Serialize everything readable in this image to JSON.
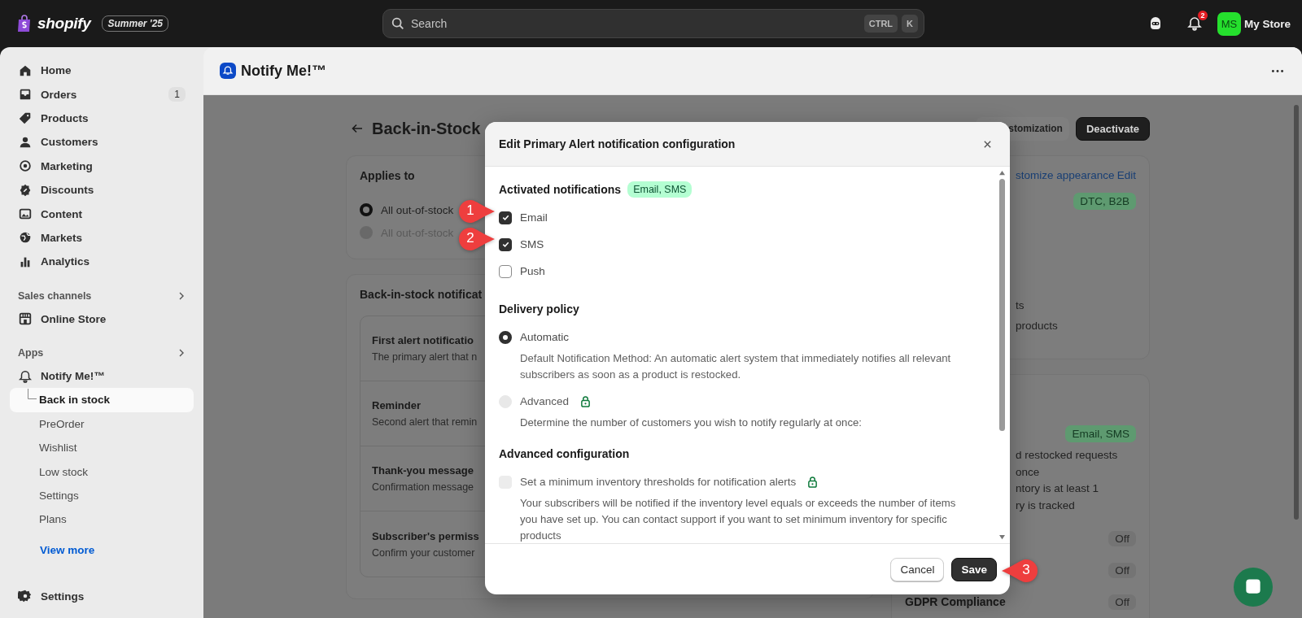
{
  "topbar": {
    "logo": "shopify",
    "edition": "Summer '25",
    "search": {
      "placeholder": "Search"
    },
    "shortcut": [
      "CTRL",
      "K"
    ],
    "notification_count": "2",
    "avatar": "MS",
    "store": "My Store"
  },
  "sidebar": {
    "nav": [
      {
        "label": "Home",
        "selected": false
      },
      {
        "label": "Orders",
        "badge": "1",
        "selected": false
      },
      {
        "label": "Products",
        "selected": false
      },
      {
        "label": "Customers",
        "selected": false
      },
      {
        "label": "Marketing",
        "selected": false
      },
      {
        "label": "Discounts",
        "selected": false
      },
      {
        "label": "Content",
        "selected": false
      },
      {
        "label": "Markets",
        "selected": false
      },
      {
        "label": "Analytics",
        "selected": false
      }
    ],
    "sales_channels": {
      "title": "Sales channels",
      "items": [
        {
          "label": "Online Store",
          "selected": false
        }
      ]
    },
    "apps": {
      "title": "Apps",
      "app": "Notify Me!™",
      "items": [
        {
          "label": "Back in stock",
          "selected": true
        },
        {
          "label": "PreOrder",
          "selected": false
        },
        {
          "label": "Wishlist",
          "selected": false
        },
        {
          "label": "Low stock",
          "selected": false
        },
        {
          "label": "Settings",
          "selected": false
        },
        {
          "label": "Plans",
          "selected": false
        }
      ],
      "more": "View more"
    },
    "settings": "Settings"
  },
  "app_header": {
    "title": "Notify Me!™"
  },
  "page": {
    "title": "Back-in-Stock",
    "buttons": [
      {
        "label": "stomization",
        "kind": "secondary"
      },
      {
        "label": "Deactivate",
        "kind": "primary"
      }
    ],
    "applies_to": {
      "title": "Applies to",
      "options": [
        {
          "label": "All out-of-stock",
          "selected": true,
          "disabled": false
        },
        {
          "label": "All out-of-stock",
          "selected": false,
          "disabled": true
        }
      ]
    },
    "notifications": {
      "title": "Back-in-stock notificat",
      "items": [
        {
          "title": "First alert notificatio",
          "text": "The primary alert that n"
        },
        {
          "title": "Reminder",
          "text": "Second alert that remin"
        },
        {
          "title": "Thank-you message",
          "text": "Confirmation message"
        },
        {
          "title": "Subscriber's permiss",
          "text": "Confirm your customer"
        }
      ]
    },
    "summary": {
      "links": [
        "stomize appearance",
        "Edit"
      ],
      "badge": "DTC, B2B",
      "lines": [
        "ts",
        "products"
      ]
    },
    "settings_card": {
      "badge": "Email, SMS",
      "lines": [
        "d restocked requests",
        "once",
        "ntory is at least 1",
        "ry is tracked"
      ],
      "rows": [
        {
          "status": "Off"
        },
        {
          "status": "Off"
        },
        {
          "label": "GDPR Compliance",
          "status": "Off"
        }
      ]
    }
  },
  "modal": {
    "title": "Edit Primary Alert notification configuration",
    "activated": {
      "title": "Activated notifications",
      "badge": "Email, SMS",
      "channels": [
        {
          "label": "Email",
          "checked": true
        },
        {
          "label": "SMS",
          "checked": true
        },
        {
          "label": "Push",
          "checked": false
        }
      ]
    },
    "delivery": {
      "title": "Delivery policy",
      "options": [
        {
          "label": "Automatic",
          "description": "Default Notification Method: An automatic alert system that immediately notifies all relevant subscribers as soon as a product is restocked.",
          "selected": true,
          "disabled": false
        },
        {
          "label": "Advanced",
          "description": "Determine the number of customers you wish to notify regularly at once:",
          "selected": false,
          "disabled": true,
          "locked": true
        }
      ]
    },
    "advanced": {
      "title": "Advanced configuration",
      "option": {
        "label": "Set a minimum inventory thresholds for notification alerts",
        "description": "Your subscribers will be notified if the inventory level equals or exceeds the number of items you have set up. You can contact support if you want to set minimum inventory for specific products",
        "checked": false,
        "disabled": true,
        "locked": true
      }
    },
    "buttons": [
      {
        "label": "Cancel",
        "kind": "secondary"
      },
      {
        "label": "Save",
        "kind": "primary"
      }
    ]
  },
  "callouts": [
    {
      "label": "1"
    },
    {
      "label": "2"
    },
    {
      "label": "3"
    }
  ]
}
